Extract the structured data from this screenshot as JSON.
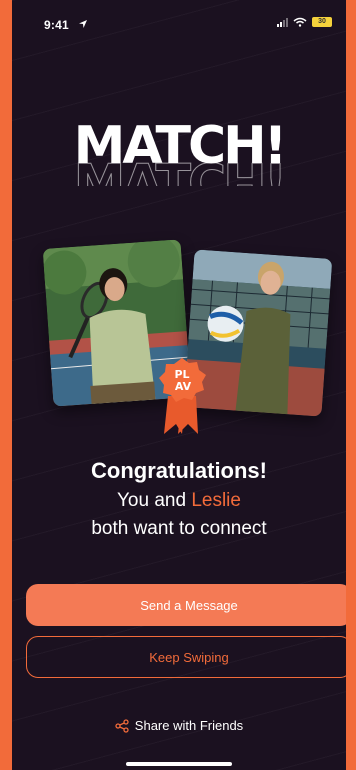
{
  "status_bar": {
    "time": "9:41",
    "battery_label": "30",
    "icons": [
      "location-arrow-icon",
      "signal-icon",
      "wifi-icon",
      "battery-icon"
    ]
  },
  "headline": "MATCH!",
  "photos": [
    {
      "name": "user-photo",
      "description_icon": "person-photo"
    },
    {
      "name": "match-photo",
      "description_icon": "person-photo"
    }
  ],
  "badge": {
    "line1": "PL",
    "line2": "AV"
  },
  "message": {
    "title": "Congratulations!",
    "line1_prefix": "You and ",
    "match_name": "Leslie",
    "line2": "both want to connect"
  },
  "actions": {
    "send_message": "Send a Message",
    "keep_swiping": "Keep Swiping",
    "share": "Share with Friends"
  },
  "colors": {
    "accent": "#f26b3a",
    "primary_button": "#f47a55",
    "background": "#1b1120",
    "frame": "#f26b3a"
  }
}
